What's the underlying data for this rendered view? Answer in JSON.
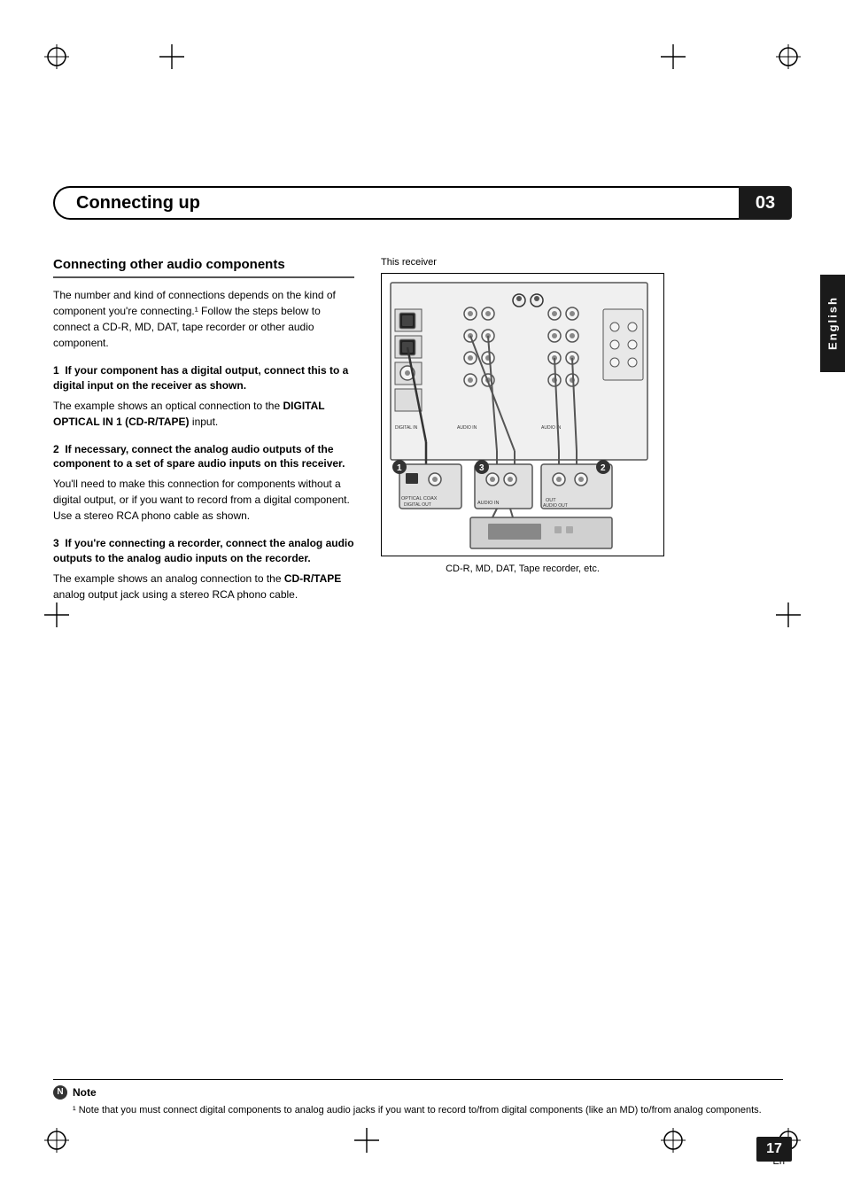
{
  "page": {
    "title": "Connecting up",
    "chapter_number": "03",
    "page_number": "17",
    "page_sub": "En",
    "language_tab": "English"
  },
  "section": {
    "title": "Connecting other audio components",
    "intro": "The number and kind of connections depends on the kind of component you're connecting.¹ Follow the steps below to connect a CD-R, MD, DAT, tape recorder or other audio component.",
    "steps": [
      {
        "number": "1",
        "heading": "If your component has a digital output, connect this to a digital input on the receiver as shown.",
        "body": "The example shows an optical connection to the DIGITAL OPTICAL IN 1 (CD-R/TAPE) input."
      },
      {
        "number": "2",
        "heading": "If necessary, connect the analog audio outputs of the component to a set of spare audio inputs on this receiver.",
        "body": "You'll need to make this connection for components without a digital output, or if you want to record from a digital component. Use a stereo RCA phono cable as shown."
      },
      {
        "number": "3",
        "heading": "If you're connecting a recorder, connect the analog audio outputs to the analog audio inputs on the recorder.",
        "body": "The example shows an analog connection to the CD-R/TAPE analog output jack using a stereo RCA phono cable."
      }
    ]
  },
  "diagram": {
    "label_top": "This receiver",
    "caption": "CD-R, MD, DAT, Tape recorder, etc."
  },
  "note": {
    "title": "Note",
    "text": "¹ Note that you must connect digital components to analog audio jacks if you want to record to/from digital components (like an MD) to/from analog components."
  }
}
